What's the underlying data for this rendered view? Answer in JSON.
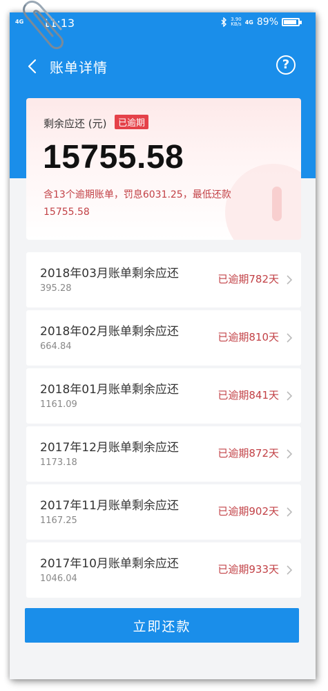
{
  "status_bar": {
    "signal": "4G",
    "time": "11:13",
    "speed": "3.90",
    "speed_unit": "KB/s",
    "net_type": "4G",
    "battery": "89%"
  },
  "navbar": {
    "title": "账单详情",
    "help_icon": "question-circle-icon",
    "back_icon": "chevron-left-icon"
  },
  "summary": {
    "label": "剩余应还 (元)",
    "tag": "已逾期",
    "amount": "15755.58",
    "note": "含13个逾期账单，罚息6031.25，最低还款15755.58"
  },
  "bills": [
    {
      "title": "2018年03月账单剩余应还",
      "amount": "395.28",
      "status": "已逾期782天"
    },
    {
      "title": "2018年02月账单剩余应还",
      "amount": "664.84",
      "status": "已逾期810天"
    },
    {
      "title": "2018年01月账单剩余应还",
      "amount": "1161.09",
      "status": "已逾期841天"
    },
    {
      "title": "2017年12月账单剩余应还",
      "amount": "1173.18",
      "status": "已逾期872天"
    },
    {
      "title": "2017年11月账单剩余应还",
      "amount": "1167.25",
      "status": "已逾期902天"
    },
    {
      "title": "2017年10月账单剩余应还",
      "amount": "1046.04",
      "status": "已逾期933天"
    }
  ],
  "pay_button": "立即还款",
  "colors": {
    "primary": "#1a8eea",
    "overdue": "#c24146",
    "tag_bg": "#e5424a"
  }
}
